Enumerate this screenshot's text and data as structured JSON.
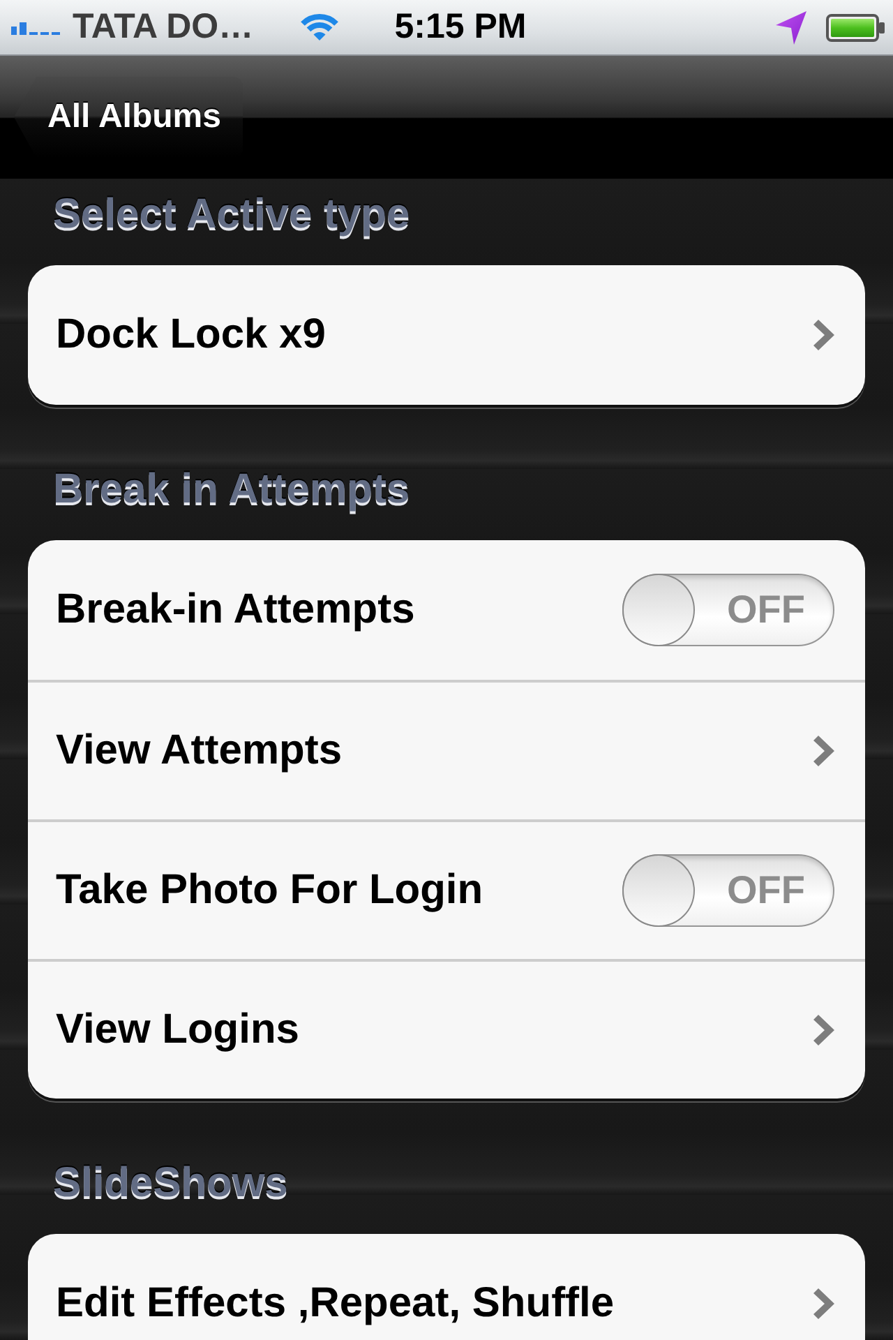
{
  "status_bar": {
    "carrier": "TATA DO…",
    "time": "5:15 PM"
  },
  "nav_bar": {
    "back_button": "All Albums"
  },
  "sections": [
    {
      "header": "Select Active type",
      "rows": [
        {
          "kind": "link",
          "label": "Dock Lock x9"
        }
      ]
    },
    {
      "header": "Break in Attempts",
      "rows": [
        {
          "kind": "switch",
          "label": "Break-in Attempts",
          "on": false,
          "state_label": "OFF"
        },
        {
          "kind": "link",
          "label": "View Attempts"
        },
        {
          "kind": "switch",
          "label": "Take Photo For Login",
          "on": false,
          "state_label": "OFF"
        },
        {
          "kind": "link",
          "label": "View Logins"
        }
      ]
    },
    {
      "header": "SlideShows",
      "rows": [
        {
          "kind": "link",
          "label": "Edit Effects ,Repeat, Shuffle"
        }
      ]
    }
  ]
}
